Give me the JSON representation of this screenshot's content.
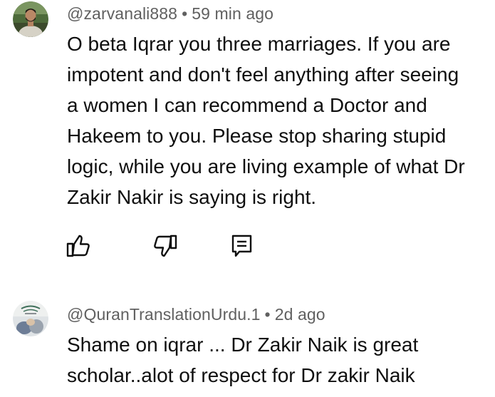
{
  "comments": [
    {
      "author": "@zarvanali888",
      "separator": "•",
      "time": "59 min ago",
      "avatar_icon": "user-photo-avatar",
      "text": "O beta Iqrar you three marriages. If you are\nimpotent and don't feel anything after seeing\na women I can recommend a Doctor and\nHakeem to you. Please stop sharing stupid\nlogic, while you are living example of what Dr\nZakir Nakir is saying is right.",
      "actions": {
        "like_icon": "thumbs-up-icon",
        "dislike_icon": "thumbs-down-icon",
        "reply_icon": "reply-icon"
      }
    },
    {
      "author": "@QuranTranslationUrdu.1",
      "separator": "•",
      "time": "2d ago",
      "avatar_icon": "channel-logo-avatar",
      "text": "Shame on iqrar ... Dr Zakir Naik is great\nscholar..alot of respect for Dr zakir Naik"
    }
  ],
  "colors": {
    "text": "#0f0f0f",
    "meta": "#606060",
    "icon": "#0f0f0f"
  }
}
